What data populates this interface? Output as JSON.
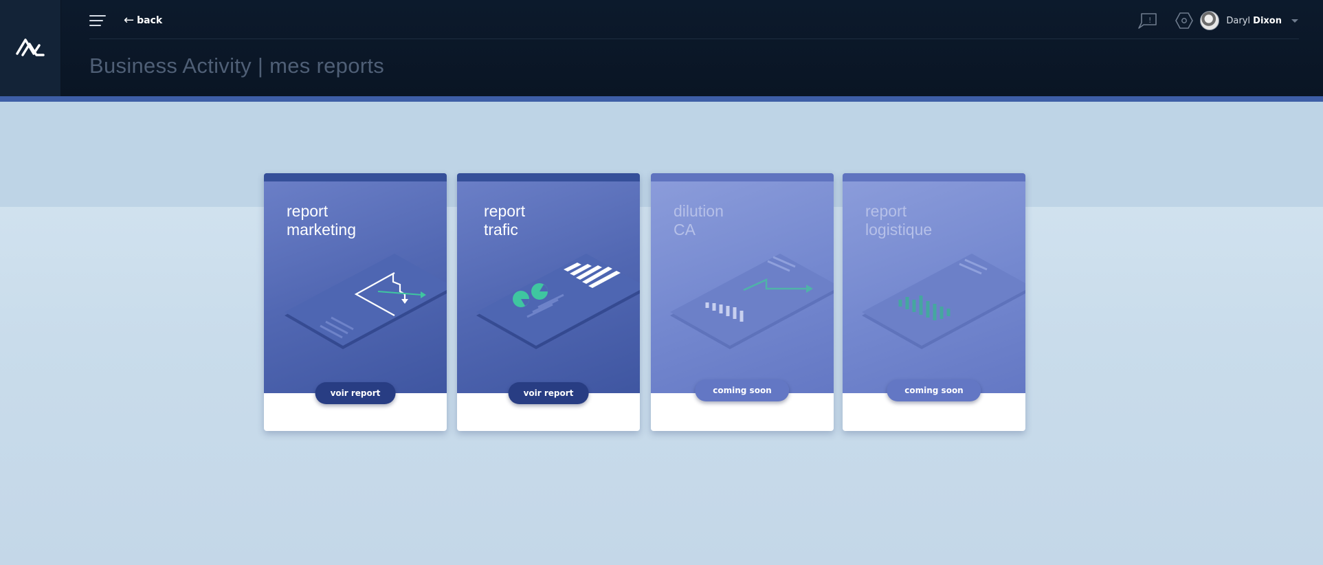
{
  "header": {
    "back_label": "back",
    "title": "Business Activity | mes reports",
    "user": {
      "first_name": "Daryl",
      "last_name": "Dixon"
    }
  },
  "cards": [
    {
      "title_line1": "report",
      "title_line2": "marketing",
      "button": "voir report",
      "status": "active"
    },
    {
      "title_line1": "report",
      "title_line2": "trafic",
      "button": "voir report",
      "status": "active"
    },
    {
      "title_line1": "dilution",
      "title_line2": "CA",
      "button": "coming soon",
      "status": "coming-soon"
    },
    {
      "title_line1": "report",
      "title_line2": "logistique",
      "button": "coming soon",
      "status": "coming-soon"
    }
  ],
  "icons": {
    "logo": "brand-logo-icon",
    "menu": "hamburger-menu-icon",
    "back": "arrow-left-icon",
    "notifications": "alert-flag-icon",
    "settings": "hexagon-settings-icon",
    "dropdown": "caret-down-icon"
  },
  "colors": {
    "header_bg": "#0c1a2c",
    "accent": "#3e5ea6",
    "card_active": "#5268b3",
    "card_inactive": "#7488cf",
    "button_active": "#283d83",
    "button_inactive": "#6377c4",
    "chart_green": "#3fc6a0"
  }
}
